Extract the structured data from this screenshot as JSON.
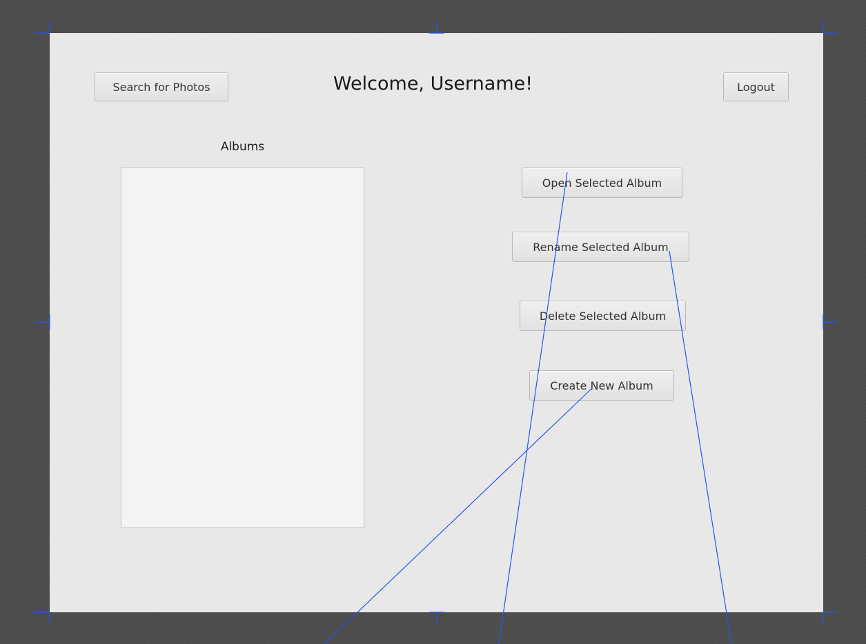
{
  "header": {
    "search_label": "Search for Photos",
    "title": "Welcome, Username!",
    "logout_label": "Logout"
  },
  "albums": {
    "label": "Albums",
    "items": []
  },
  "actions": {
    "open_label": "Open Selected Album",
    "rename_label": "Rename Selected Album",
    "delete_label": "Delete Selected Album",
    "create_label": "Create New Album"
  },
  "colors": {
    "editor_background": "#4d4d4d",
    "canvas": "#e8e8e8",
    "guide_lines": "#2255ee"
  }
}
